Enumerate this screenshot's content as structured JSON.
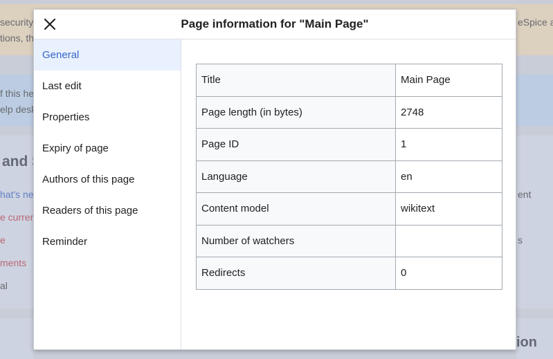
{
  "background": {
    "notice_left_1": "security",
    "notice_left_2": "tions, th",
    "notice_right": "eSpice a",
    "blue_left_1": "f this he",
    "blue_left_2": "elp desk",
    "heading_left": "and S",
    "left_links": [
      "hat's ne",
      "e curren",
      "e",
      "ments",
      "al"
    ],
    "right_link_1": "ent",
    "right_link_2": "s",
    "heading_bottom": "ion"
  },
  "dialog": {
    "title": "Page information for \"Main Page\"",
    "close_icon": "close-icon",
    "nav": [
      {
        "label": "General",
        "active": true
      },
      {
        "label": "Last edit",
        "active": false
      },
      {
        "label": "Properties",
        "active": false
      },
      {
        "label": "Expiry of page",
        "active": false
      },
      {
        "label": "Authors of this page",
        "active": false
      },
      {
        "label": "Readers of this page",
        "active": false
      },
      {
        "label": "Reminder",
        "active": false
      }
    ],
    "table": [
      {
        "label": "Title",
        "value": "Main Page"
      },
      {
        "label": "Page length (in bytes)",
        "value": "2748"
      },
      {
        "label": "Page ID",
        "value": "1"
      },
      {
        "label": "Language",
        "value": "en"
      },
      {
        "label": "Content model",
        "value": "wikitext"
      },
      {
        "label": "Number of watchers",
        "value": ""
      },
      {
        "label": "Redirects",
        "value": "0"
      }
    ]
  },
  "colors": {
    "accent": "#3366cc",
    "active_nav_bg": "#eaf1fe",
    "table_border": "#a2a9b1",
    "label_bg": "#f8f9fa"
  }
}
